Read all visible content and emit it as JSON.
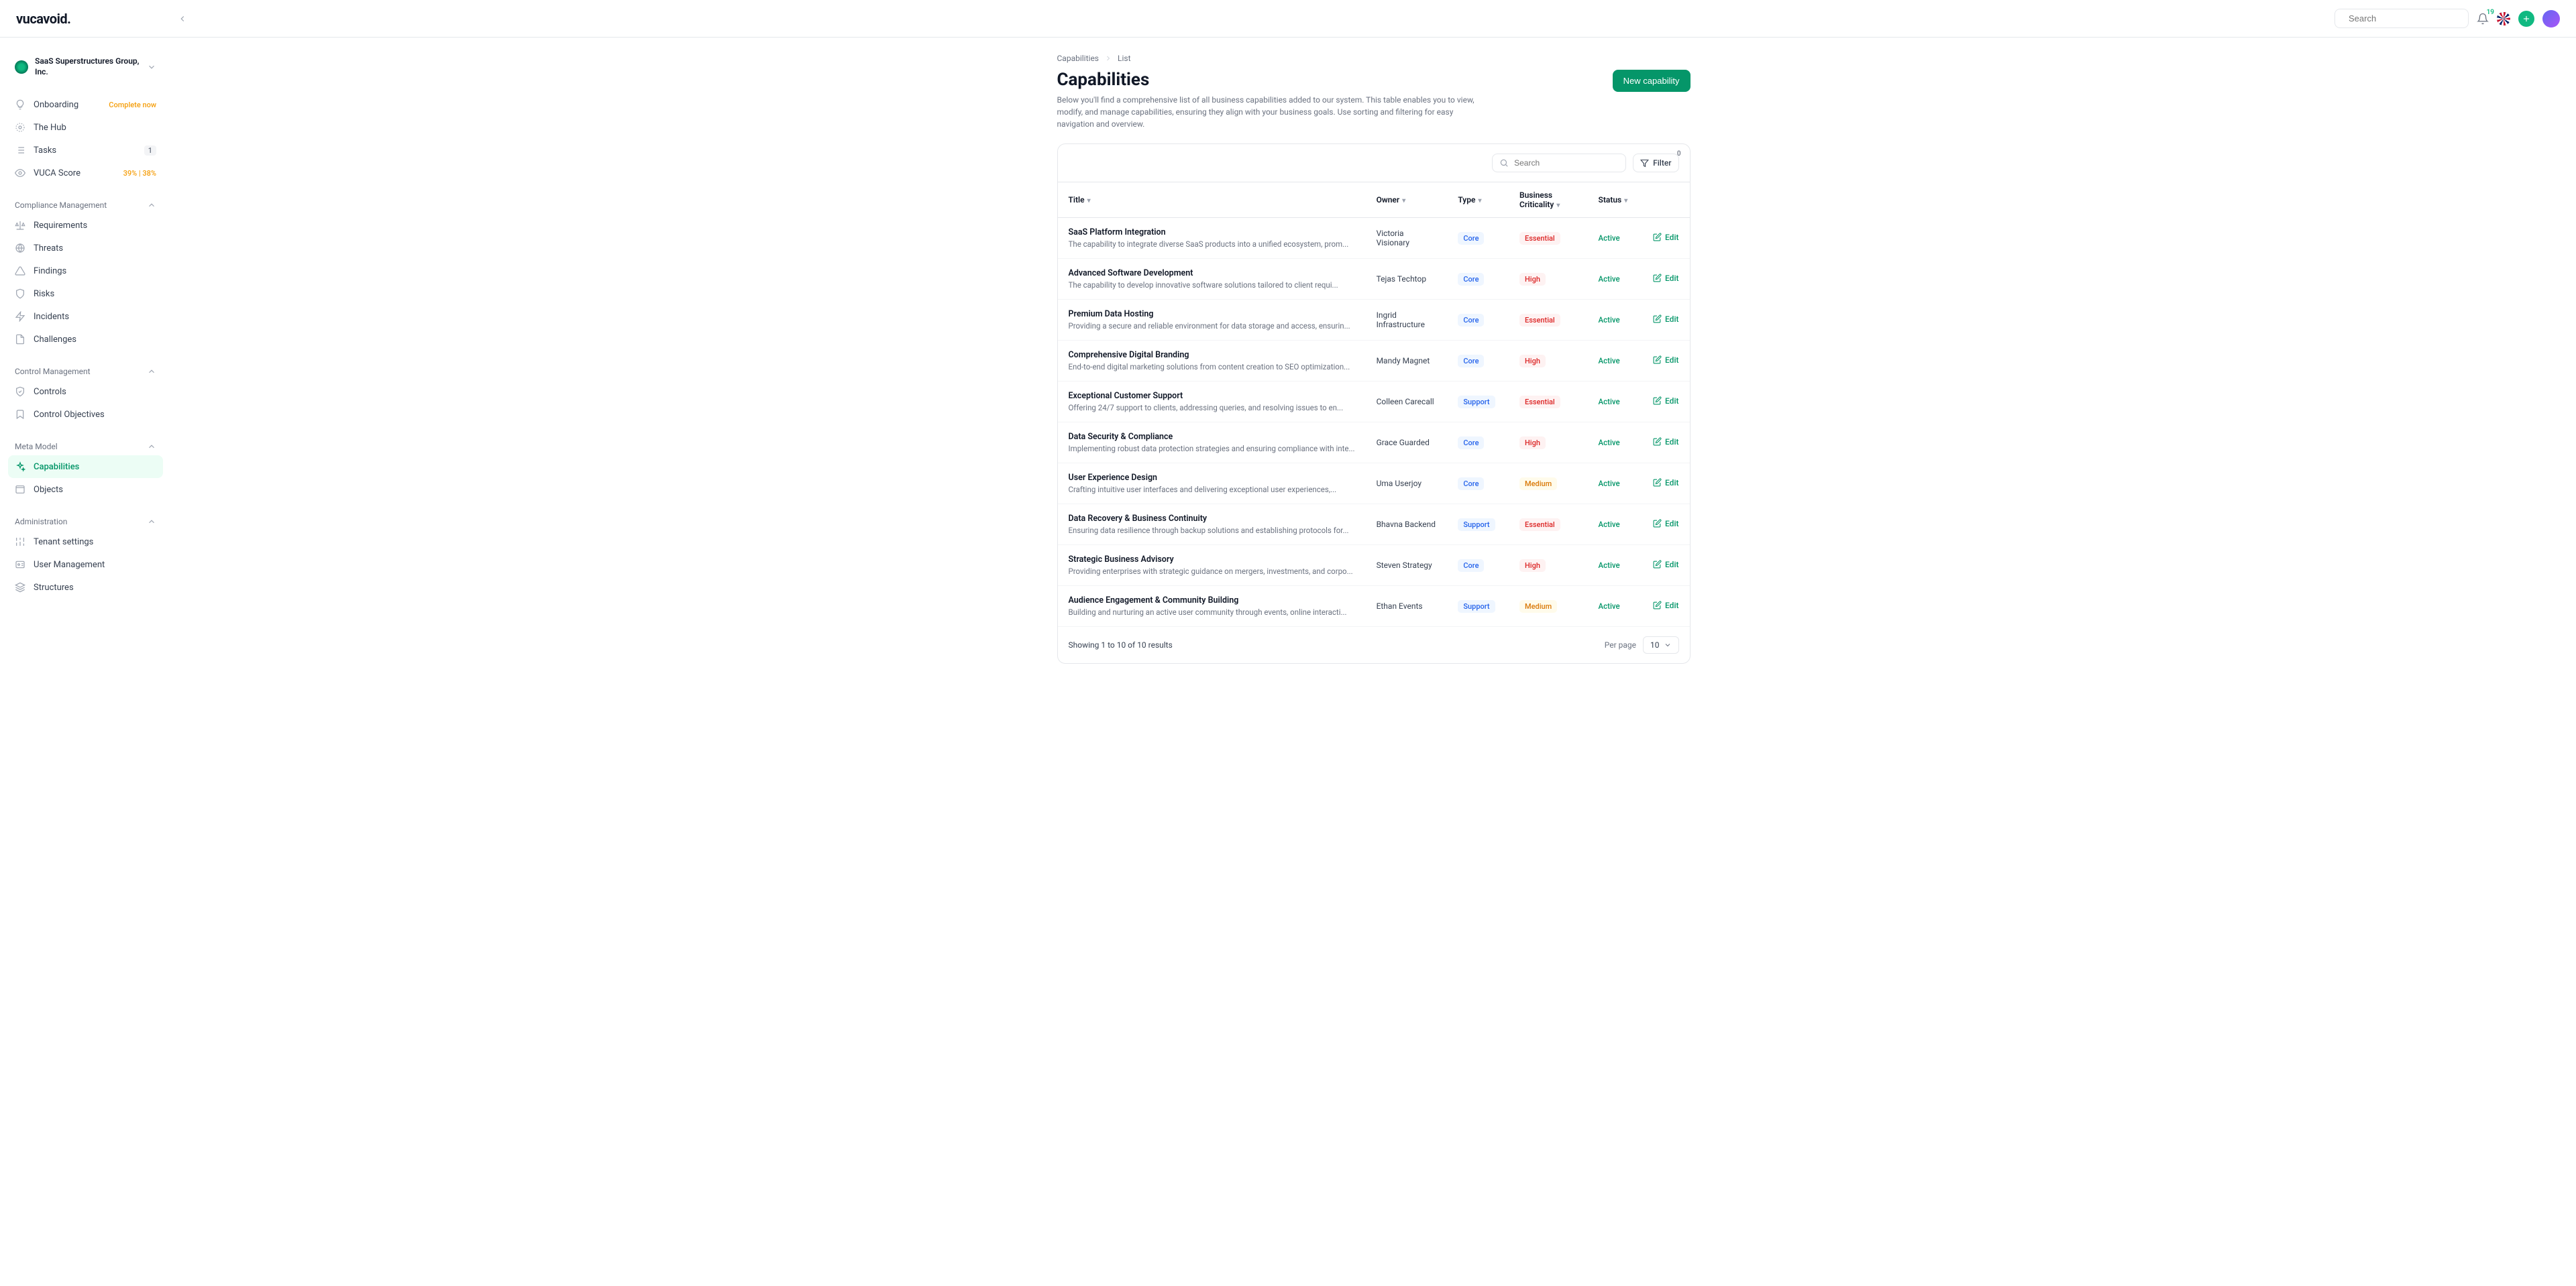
{
  "header": {
    "logo": "vucavoid.",
    "search_placeholder": "Search",
    "notification_count": "19"
  },
  "tenant": {
    "name": "SaaS Superstructures Group, Inc."
  },
  "sidebar": {
    "top": [
      {
        "label": "Onboarding",
        "badge": "Complete now",
        "badge_class": "badge-orange"
      },
      {
        "label": "The Hub"
      },
      {
        "label": "Tasks",
        "count": "1"
      },
      {
        "label": "VUCA Score",
        "badge": "39% | 38%",
        "badge_class": "badge-orange"
      }
    ],
    "sections": [
      {
        "title": "Compliance Management",
        "items": [
          {
            "label": "Requirements"
          },
          {
            "label": "Threats"
          },
          {
            "label": "Findings"
          },
          {
            "label": "Risks"
          },
          {
            "label": "Incidents"
          },
          {
            "label": "Challenges"
          }
        ]
      },
      {
        "title": "Control Management",
        "items": [
          {
            "label": "Controls"
          },
          {
            "label": "Control Objectives"
          }
        ]
      },
      {
        "title": "Meta Model",
        "items": [
          {
            "label": "Capabilities",
            "active": true
          },
          {
            "label": "Objects"
          }
        ]
      },
      {
        "title": "Administration",
        "items": [
          {
            "label": "Tenant settings"
          },
          {
            "label": "User Management"
          },
          {
            "label": "Structures"
          }
        ]
      }
    ]
  },
  "breadcrumb": {
    "parent": "Capabilities",
    "current": "List"
  },
  "page": {
    "title": "Capabilities",
    "description": "Below you'll find a comprehensive list of all business capabilities added to our system. This table enables you to view, modify, and manage capabilities, ensuring they align with your business goals. Use sorting and filtering for easy navigation and overview.",
    "new_button": "New capability"
  },
  "toolbar": {
    "search_placeholder": "Search",
    "filter_label": "Filter",
    "filter_count": "0"
  },
  "columns": {
    "title": "Title",
    "owner": "Owner",
    "type": "Type",
    "criticality": "Business Criticality",
    "status": "Status"
  },
  "rows": [
    {
      "title": "SaaS Platform Integration",
      "desc": "The capability to integrate diverse SaaS products into a unified ecosystem, prom...",
      "owner": "Victoria Visionary",
      "type": "Core",
      "criticality": "Essential",
      "status": "Active"
    },
    {
      "title": "Advanced Software Development",
      "desc": "The capability to develop innovative software solutions tailored to client requi...",
      "owner": "Tejas Techtop",
      "type": "Core",
      "criticality": "High",
      "status": "Active"
    },
    {
      "title": "Premium Data Hosting",
      "desc": "Providing a secure and reliable environment for data storage and access, ensurin...",
      "owner": "Ingrid Infrastructure",
      "type": "Core",
      "criticality": "Essential",
      "status": "Active"
    },
    {
      "title": "Comprehensive Digital Branding",
      "desc": "End-to-end digital marketing solutions from content creation to SEO optimization...",
      "owner": "Mandy Magnet",
      "type": "Core",
      "criticality": "High",
      "status": "Active"
    },
    {
      "title": "Exceptional Customer Support",
      "desc": "Offering 24/7 support to clients, addressing queries, and resolving issues to en...",
      "owner": "Colleen Carecall",
      "type": "Support",
      "criticality": "Essential",
      "status": "Active"
    },
    {
      "title": "Data Security & Compliance",
      "desc": "Implementing robust data protection strategies and ensuring compliance with inte...",
      "owner": "Grace Guarded",
      "type": "Core",
      "criticality": "High",
      "status": "Active"
    },
    {
      "title": "User Experience Design",
      "desc": "Crafting intuitive user interfaces and delivering exceptional user experiences,...",
      "owner": "Uma Userjoy",
      "type": "Core",
      "criticality": "Medium",
      "status": "Active"
    },
    {
      "title": "Data Recovery & Business Continuity",
      "desc": "Ensuring data resilience through backup solutions and establishing protocols for...",
      "owner": "Bhavna Backend",
      "type": "Support",
      "criticality": "Essential",
      "status": "Active"
    },
    {
      "title": "Strategic Business Advisory",
      "desc": "Providing enterprises with strategic guidance on mergers, investments, and corpo...",
      "owner": "Steven Strategy",
      "type": "Core",
      "criticality": "High",
      "status": "Active"
    },
    {
      "title": "Audience Engagement & Community Building",
      "desc": "Building and nurturing an active user community through events, online interacti...",
      "owner": "Ethan Events",
      "type": "Support",
      "criticality": "Medium",
      "status": "Active"
    }
  ],
  "edit_label": "Edit",
  "footer": {
    "info": "Showing 1 to 10 of 10 results",
    "per_page_label": "Per page",
    "per_page_value": "10"
  }
}
